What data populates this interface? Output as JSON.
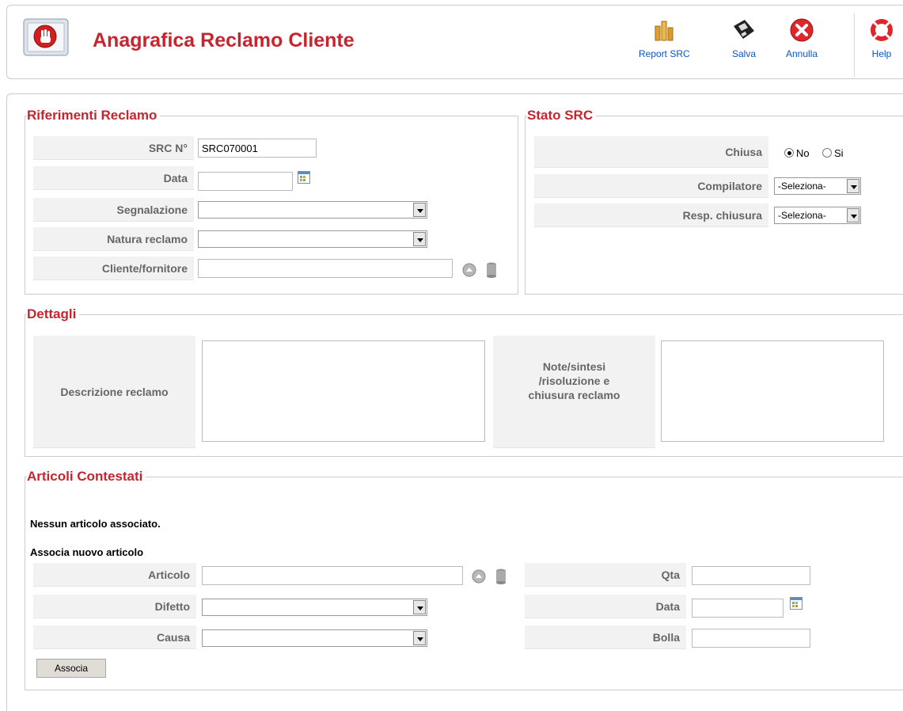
{
  "header": {
    "title": "Anagrafica Reclamo Cliente",
    "page_icon": "stop-hand-icon",
    "buttons": [
      {
        "label": "Report SRC",
        "icon": "report-chart-icon"
      },
      {
        "label": "Salva",
        "icon": "save-floppy-icon"
      },
      {
        "label": "Annulla",
        "icon": "cancel-circle-icon"
      },
      {
        "label": "Help",
        "icon": "help-lifebuoy-icon"
      }
    ]
  },
  "riferimenti": {
    "legend": "Riferimenti Reclamo",
    "src_label": "SRC N°",
    "src_value": "SRC070001",
    "data_label": "Data",
    "data_value": "",
    "segnalazione_label": "Segnalazione",
    "segnalazione_value": "",
    "natura_label": "Natura reclamo",
    "natura_value": "",
    "cliente_label": "Cliente/fornitore",
    "cliente_value": ""
  },
  "stato": {
    "legend": "Stato SRC",
    "chiusa_label": "Chiusa",
    "chiusa_options": [
      "No",
      "Si"
    ],
    "chiusa_selected": "No",
    "compilatore_label": "Compilatore",
    "compilatore_value": "-Seleziona-",
    "resp_label": "Resp. chiusura",
    "resp_value": "-Seleziona-"
  },
  "dettagli": {
    "legend": "Dettagli",
    "descrizione_label": "Descrizione reclamo",
    "note_label_lines": [
      "Note/sintesi",
      "/risoluzione e",
      "chiusura reclamo"
    ]
  },
  "articoli": {
    "legend": "Articoli Contestati",
    "empty_message": "Nessun articolo associato.",
    "new_heading": "Associa nuovo articolo",
    "articolo_label": "Articolo",
    "difetto_label": "Difetto",
    "causa_label": "Causa",
    "qta_label": "Qta",
    "data_label": "Data",
    "bolla_label": "Bolla",
    "associa_button": "Associa"
  },
  "colors": {
    "accent": "#c7242e",
    "link": "#0b55c4",
    "label_bg": "#f2f2f2"
  }
}
